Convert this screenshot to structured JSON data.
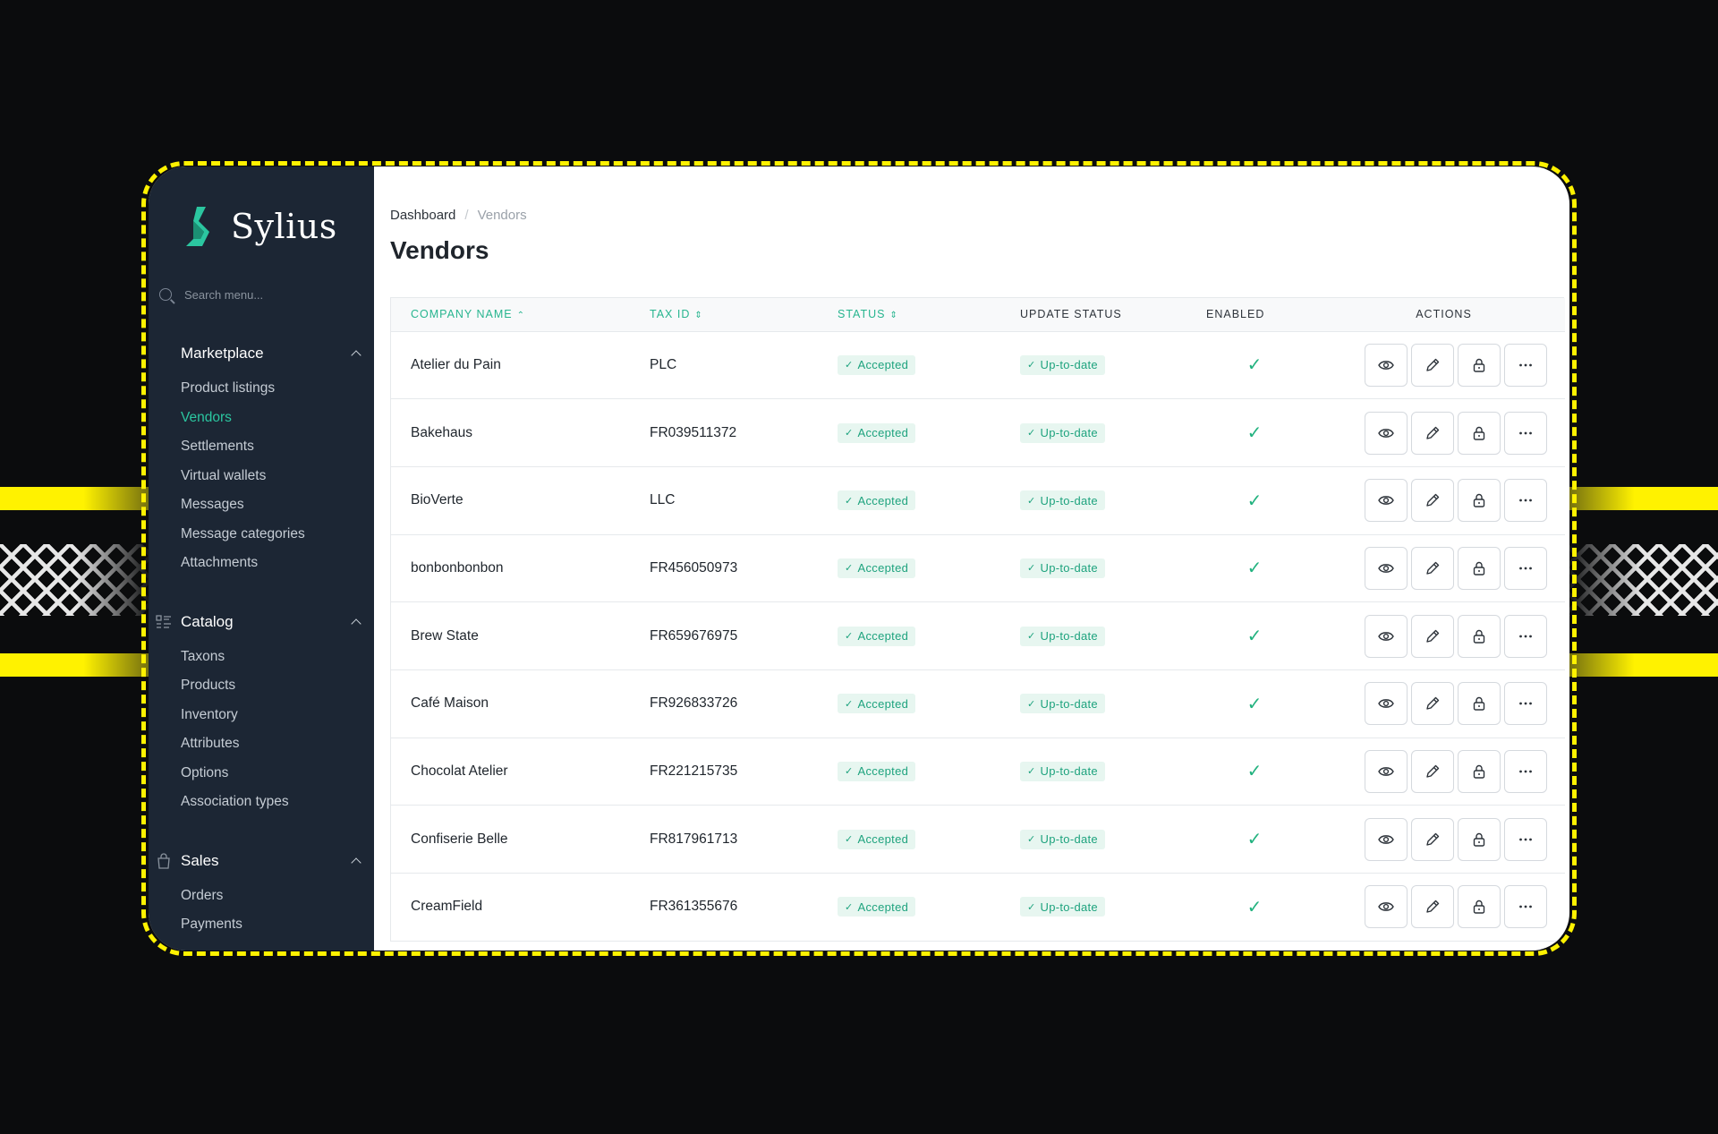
{
  "app": {
    "name": "Sylius",
    "brand_color": "#2bc6a0"
  },
  "sidebar": {
    "search_placeholder": "Search menu...",
    "sections": [
      {
        "title": "Marketplace",
        "icon": "marketplace-icon",
        "items": [
          "Product listings",
          "Vendors",
          "Settlements",
          "Virtual wallets",
          "Messages",
          "Message categories",
          "Attachments"
        ],
        "active": "Vendors"
      },
      {
        "title": "Catalog",
        "icon": "catalog-icon",
        "items": [
          "Taxons",
          "Products",
          "Inventory",
          "Attributes",
          "Options",
          "Association types"
        ]
      },
      {
        "title": "Sales",
        "icon": "shopping-bag-icon",
        "items": [
          "Orders",
          "Payments"
        ]
      }
    ]
  },
  "breadcrumb": {
    "home": "Dashboard",
    "separator": "/",
    "current": "Vendors"
  },
  "page": {
    "title": "Vendors"
  },
  "table": {
    "columns": {
      "company": "COMPANY NAME",
      "tax": "TAX ID",
      "status": "STATUS",
      "update": "UPDATE STATUS",
      "enabled": "ENABLED",
      "actions": "ACTIONS"
    },
    "rows": [
      {
        "company": "Atelier du Pain",
        "tax": "PLC",
        "status": "Accepted",
        "update": "Up-to-date"
      },
      {
        "company": "Bakehaus",
        "tax": "FR039511372",
        "status": "Accepted",
        "update": "Up-to-date"
      },
      {
        "company": "BioVerte",
        "tax": "LLC",
        "status": "Accepted",
        "update": "Up-to-date"
      },
      {
        "company": "bonbonbonbon",
        "tax": "FR456050973",
        "status": "Accepted",
        "update": "Up-to-date"
      },
      {
        "company": "Brew State",
        "tax": "FR659676975",
        "status": "Accepted",
        "update": "Up-to-date"
      },
      {
        "company": "Café Maison",
        "tax": "FR926833726",
        "status": "Accepted",
        "update": "Up-to-date"
      },
      {
        "company": "Chocolat Atelier",
        "tax": "FR221215735",
        "status": "Accepted",
        "update": "Up-to-date"
      },
      {
        "company": "Confiserie Belle",
        "tax": "FR817961713",
        "status": "Accepted",
        "update": "Up-to-date"
      },
      {
        "company": "CreamField",
        "tax": "FR361355676",
        "status": "Accepted",
        "update": "Up-to-date"
      }
    ]
  },
  "colors": {
    "sidebar_bg": "#1c2634",
    "accent_yellow": "#fff200",
    "badge_bg": "#e7f6f0",
    "badge_text": "#1ea37e"
  }
}
